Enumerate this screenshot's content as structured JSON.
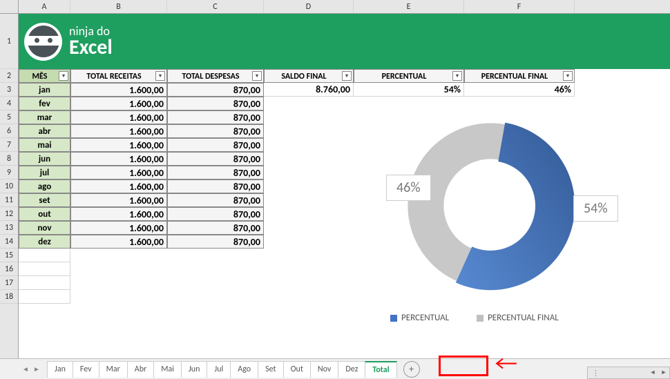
{
  "columns": [
    "A",
    "B",
    "C",
    "D",
    "E",
    "F"
  ],
  "rows_visible": 18,
  "banner": {
    "line1": "ninja do",
    "line2": "Excel"
  },
  "headers": {
    "mes": "MÊS",
    "receitas": "TOTAL RECEITAS",
    "despesas": "TOTAL DESPESAS",
    "saldo": "SALDO FINAL",
    "percentual": "PERCENTUAL",
    "percentual_final": "PERCENTUAL FINAL"
  },
  "table": [
    {
      "mes": "jan",
      "receitas": "1.600,00",
      "despesas": "870,00"
    },
    {
      "mes": "fev",
      "receitas": "1.600,00",
      "despesas": "870,00"
    },
    {
      "mes": "mar",
      "receitas": "1.600,00",
      "despesas": "870,00"
    },
    {
      "mes": "abr",
      "receitas": "1.600,00",
      "despesas": "870,00"
    },
    {
      "mes": "mai",
      "receitas": "1.600,00",
      "despesas": "870,00"
    },
    {
      "mes": "jun",
      "receitas": "1.600,00",
      "despesas": "870,00"
    },
    {
      "mes": "jul",
      "receitas": "1.600,00",
      "despesas": "870,00"
    },
    {
      "mes": "ago",
      "receitas": "1.600,00",
      "despesas": "870,00"
    },
    {
      "mes": "set",
      "receitas": "1.600,00",
      "despesas": "870,00"
    },
    {
      "mes": "out",
      "receitas": "1.600,00",
      "despesas": "870,00"
    },
    {
      "mes": "nov",
      "receitas": "1.600,00",
      "despesas": "870,00"
    },
    {
      "mes": "dez",
      "receitas": "1.600,00",
      "despesas": "870,00"
    }
  ],
  "summary": {
    "saldo_final": "8.760,00",
    "percentual": "54%",
    "percentual_final": "46%"
  },
  "chart_data": {
    "type": "pie",
    "title": "",
    "series": [
      {
        "name": "PERCENTUAL",
        "value": 54,
        "label": "54%",
        "color": "#4472c4"
      },
      {
        "name": "PERCENTUAL FINAL",
        "value": 46,
        "label": "46%",
        "color": "#c0c0c0"
      }
    ],
    "donut": true
  },
  "legend": {
    "percentual": "PERCENTUAL",
    "percentual_final": "PERCENTUAL FINAL"
  },
  "tabs": [
    "Jan",
    "Fev",
    "Mar",
    "Abr",
    "Mai",
    "Jun",
    "Jul",
    "Ago",
    "Set",
    "Out",
    "Nov",
    "Dez",
    "Total"
  ],
  "active_tab": "Total"
}
